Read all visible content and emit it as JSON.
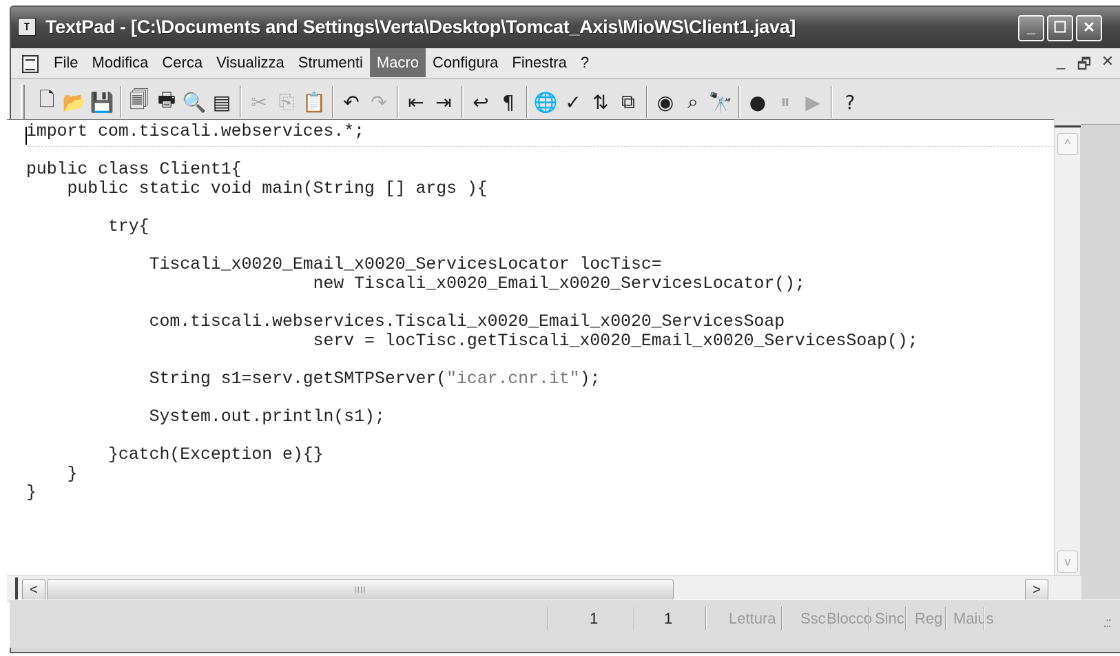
{
  "window": {
    "title": "TextPad - [C:\\Documents and Settings\\Verta\\Desktop\\Tomcat_Axis\\MioWS\\Client1.java]",
    "app_icon": "textpad-icon",
    "controls": {
      "minimize": "_",
      "maximize": "☐",
      "close": "✕"
    }
  },
  "menu": {
    "items": [
      {
        "label": "File",
        "active": false
      },
      {
        "label": "Modifica",
        "active": false
      },
      {
        "label": "Cerca",
        "active": false
      },
      {
        "label": "Visualizza",
        "active": false
      },
      {
        "label": "Strumenti",
        "active": false
      },
      {
        "label": "Macro",
        "active": true
      },
      {
        "label": "Configura",
        "active": false
      },
      {
        "label": "Finestra",
        "active": false
      },
      {
        "label": "?",
        "active": false
      }
    ],
    "mdi": {
      "minimize": "_",
      "restore": "🗗",
      "close": "✕"
    }
  },
  "toolbar": {
    "buttons": [
      {
        "icon": "new-document-icon",
        "glyph": "🗋",
        "enabled": true
      },
      {
        "icon": "open-folder-icon",
        "glyph": "📂",
        "enabled": true
      },
      {
        "icon": "save-icon",
        "glyph": "💾",
        "enabled": false
      },
      {
        "icon": "save-all-icon",
        "glyph": "🗐",
        "enabled": true
      },
      {
        "icon": "print-icon",
        "glyph": "🖶",
        "enabled": true
      },
      {
        "icon": "print-preview-icon",
        "glyph": "🔍",
        "enabled": true
      },
      {
        "icon": "document-properties-icon",
        "glyph": "▤",
        "enabled": true
      },
      {
        "icon": "cut-icon",
        "glyph": "✂",
        "enabled": false
      },
      {
        "icon": "copy-icon",
        "glyph": "⎘",
        "enabled": false
      },
      {
        "icon": "paste-icon",
        "glyph": "📋",
        "enabled": false
      },
      {
        "icon": "undo-icon",
        "glyph": "↶",
        "enabled": true
      },
      {
        "icon": "redo-icon",
        "glyph": "↷",
        "enabled": false
      },
      {
        "icon": "unindent-icon",
        "glyph": "⇤",
        "enabled": true
      },
      {
        "icon": "indent-icon",
        "glyph": "⇥",
        "enabled": true
      },
      {
        "icon": "word-wrap-icon",
        "glyph": "↩",
        "enabled": true
      },
      {
        "icon": "paragraph-icon",
        "glyph": "¶",
        "enabled": true
      },
      {
        "icon": "web-browser-icon",
        "glyph": "🌐",
        "enabled": true
      },
      {
        "icon": "spelling-icon",
        "glyph": "✓",
        "enabled": true
      },
      {
        "icon": "sort-icon",
        "glyph": "⇅",
        "enabled": true
      },
      {
        "icon": "compare-files-icon",
        "glyph": "⧉",
        "enabled": true
      },
      {
        "icon": "view-icon",
        "glyph": "◉",
        "enabled": true
      },
      {
        "icon": "find-replace-icon",
        "glyph": "⌕",
        "enabled": true
      },
      {
        "icon": "find-in-files-icon",
        "glyph": "🔭",
        "enabled": true
      },
      {
        "icon": "record-macro-icon",
        "glyph": "●",
        "enabled": true
      },
      {
        "icon": "pause-macro-icon",
        "glyph": "⏸",
        "enabled": false
      },
      {
        "icon": "play-macro-icon",
        "glyph": "▶",
        "enabled": false
      },
      {
        "icon": "context-help-icon",
        "glyph": "?",
        "enabled": true
      }
    ]
  },
  "editor": {
    "lines": [
      "import com.tiscali.webservices.*;",
      "",
      "public class Client1{",
      "    public static void main(String [] args ){",
      "",
      "        try{",
      "",
      "            Tiscali_x0020_Email_x0020_ServicesLocator locTisc=",
      "                            new Tiscali_x0020_Email_x0020_ServicesLocator();",
      "",
      "            com.tiscali.webservices.Tiscali_x0020_Email_x0020_ServicesSoap",
      "                            serv = locTisc.getTiscali_x0020_Email_x0020_ServicesSoap();",
      "",
      "            String s1=serv.getSMTPServer(\"icar.cnr.it\");",
      "",
      "            System.out.println(s1);",
      "",
      "        }catch(Exception e){}",
      "    }",
      "}"
    ],
    "string_literal": "\"icar.cnr.it\""
  },
  "scrollbars": {
    "horizontal": {
      "left": "<",
      "right": ">",
      "thumb_grip": "IIII"
    },
    "vertical": {
      "up": "^",
      "down": "v"
    }
  },
  "statusbar": {
    "line": "1",
    "column": "1",
    "flags": [
      "Lettura",
      "Ssc",
      "Blocco",
      "Sinc",
      "Reg",
      "Maius"
    ],
    "grip": ".::"
  }
}
